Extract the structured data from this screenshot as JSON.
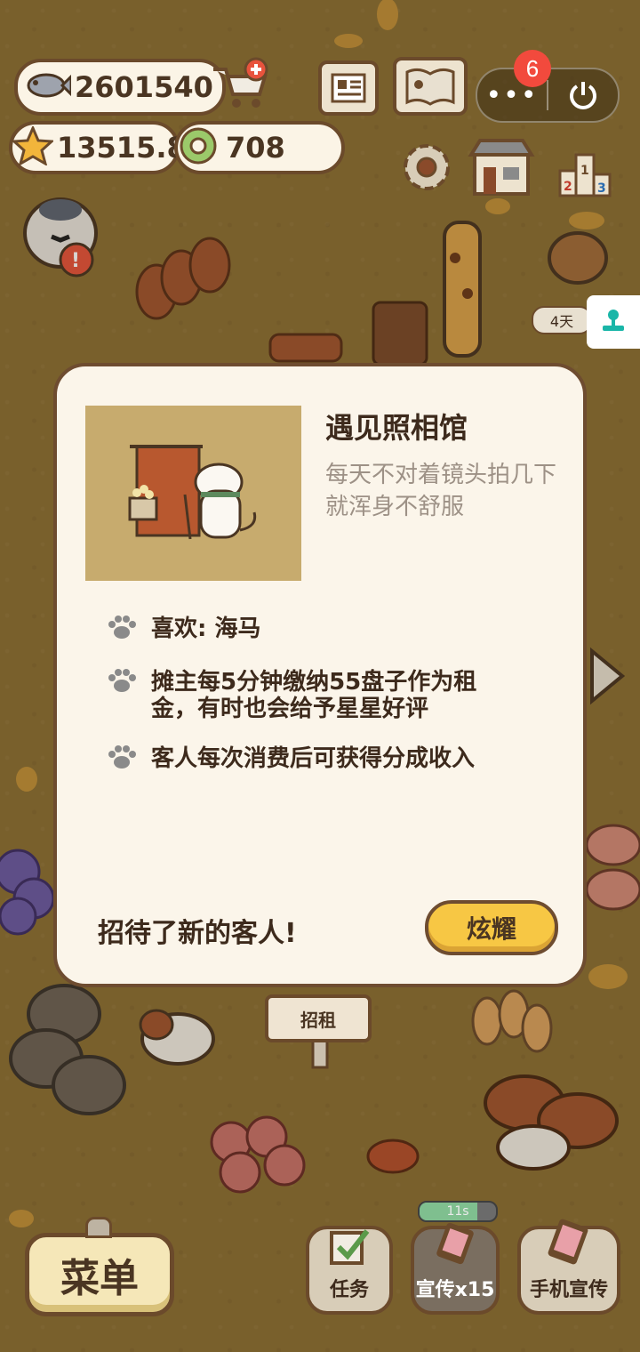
{
  "resources": {
    "fish": "2601540",
    "stars": "13515.8",
    "coins": "708"
  },
  "notification_count": "6",
  "days_label": "4天",
  "modal": {
    "title": "遇见照相馆",
    "description": "每天不对着镜头拍几下就浑身不舒服",
    "perks": [
      "喜欢: 海马",
      "摊主每5分钟缴纳55盘子作为租金，有时也会给予星星好评",
      "客人每次消费后可获得分成收入"
    ],
    "footer_text": "招待了新的客人!",
    "share_button": "炫耀"
  },
  "stall_sign": "招租",
  "bottom": {
    "menu": "菜单",
    "tasks": "任务",
    "promo": "宣传x15",
    "phone_promo": "手机宣传",
    "timer": "11s",
    "timer_progress": 0.75
  },
  "colors": {
    "accent_yellow": "#f7c744",
    "border_brown": "#6e4c30",
    "badge_red": "#f24a3d"
  }
}
